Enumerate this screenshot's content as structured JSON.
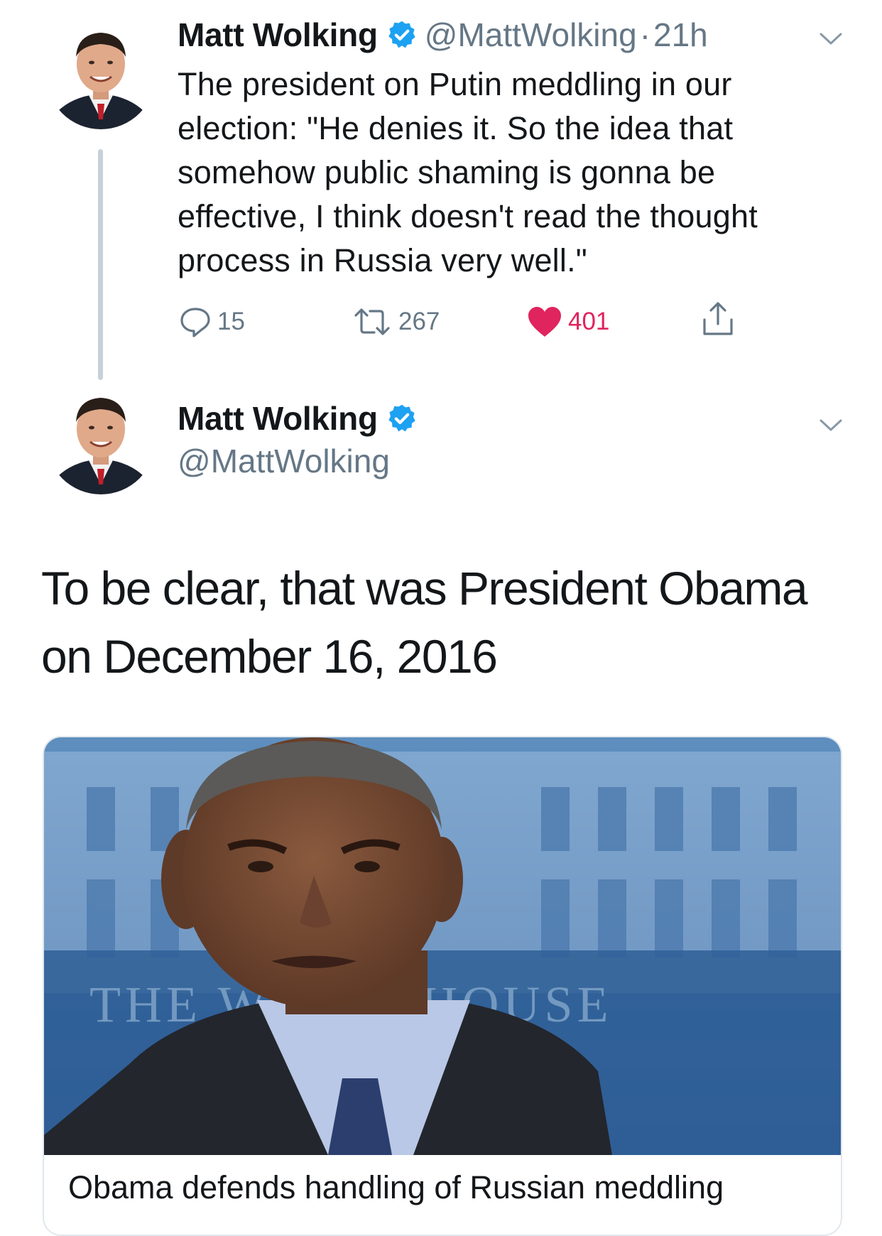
{
  "tweet1": {
    "author_name": "Matt Wolking",
    "handle": "@MattWolking",
    "separator": "·",
    "time": "21h",
    "text": "The president on Putin meddling in our election: \"He denies it. So the idea that somehow public shaming is gonna be effective, I think doesn't read the thought process in Russia very well.\"",
    "reply_count": "15",
    "retweet_count": "267",
    "like_count": "401"
  },
  "tweet2": {
    "author_name": "Matt Wolking",
    "handle": "@MattWolking",
    "text": "To be clear, that was President Obama on December 16, 2016",
    "card": {
      "image_sign_text": "THE WHITE HOUSE",
      "title": "Obama defends handling of Russian meddling"
    }
  },
  "icons": {
    "verified": "verified-badge-icon",
    "chevron": "chevron-down-icon",
    "reply": "reply-icon",
    "retweet": "retweet-icon",
    "like": "heart-icon",
    "share": "share-icon"
  },
  "colors": {
    "verified_blue": "#1da1f2",
    "like_red": "#e0245e",
    "secondary_text": "#657786",
    "thread_line": "#c8d1d8"
  }
}
